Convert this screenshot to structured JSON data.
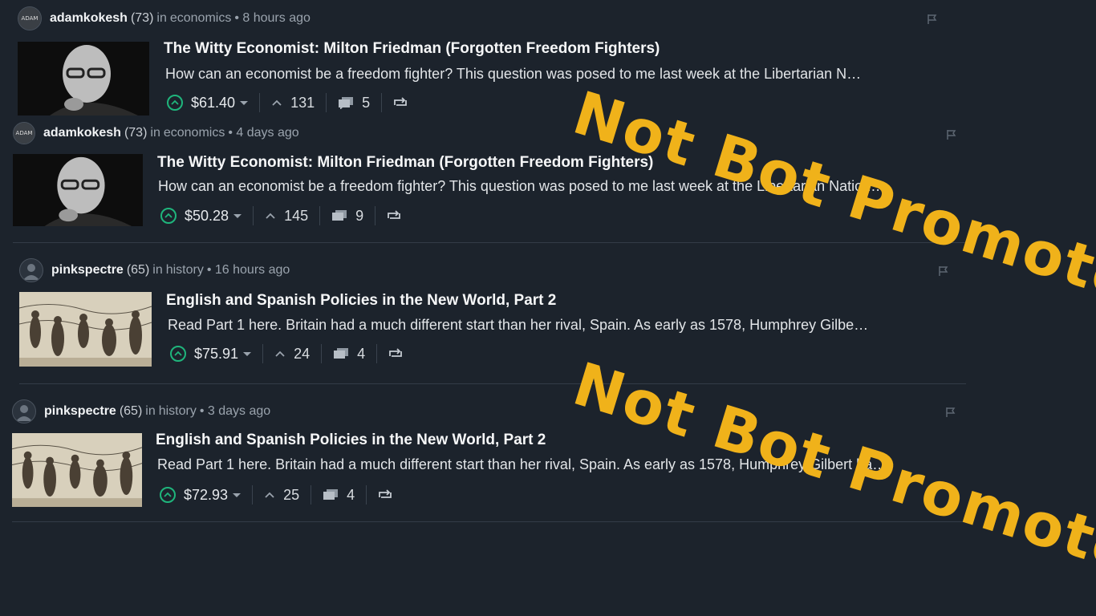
{
  "posts": [
    {
      "author": "adamkokesh",
      "rep": "(73)",
      "in": "in",
      "category": "economics",
      "time": "• 8 hours ago",
      "title": "The Witty Economist: Milton Friedman (Forgotten Freedom Fighters)",
      "body": "How can an economist be a freedom fighter? This question was posed to me last week at the Libertarian N…",
      "payout": "$61.40",
      "votes": "131",
      "comments": "5",
      "thumb": "milton"
    },
    {
      "author": "adamkokesh",
      "rep": "(73)",
      "in": "in",
      "category": "economics",
      "time": "• 4 days ago",
      "title": "The Witty Economist: Milton Friedman (Forgotten Freedom Fighters)",
      "body": "How can an economist be a freedom fighter? This question was posed to me last week at the Libertarian Nation…",
      "payout": "$50.28",
      "votes": "145",
      "comments": "9",
      "thumb": "milton"
    },
    {
      "author": "pinkspectre",
      "rep": "(65)",
      "in": "in",
      "category": "history",
      "time": "• 16 hours ago",
      "title": "English and Spanish Policies in the New World, Part 2",
      "body": "Read Part 1 here. Britain had a much different start than her rival, Spain. As early as 1578, Humphrey Gilbe…",
      "payout": "$75.91",
      "votes": "24",
      "comments": "4",
      "thumb": "engraving"
    },
    {
      "author": "pinkspectre",
      "rep": "(65)",
      "in": "in",
      "category": "history",
      "time": "• 3 days ago",
      "title": "English and Spanish Policies in the New World, Part 2",
      "body": "Read Part 1 here. Britain had a much different start than her rival, Spain. As early as 1578, Humphrey Gilbert ha…",
      "payout": "$72.93",
      "votes": "25",
      "comments": "4",
      "thumb": "engraving"
    }
  ],
  "stamps": [
    "Not Bot Promoted",
    "Not Bot Promoted"
  ],
  "colors": {
    "background": "#1c232c",
    "upvote_accent": "#1fb57c",
    "stamp": "#f0b21a"
  },
  "icons": {
    "vote": "upvote-circle-icon",
    "votes": "chevron-up-icon",
    "comments": "comments-icon",
    "reblog": "reblog-icon",
    "flag": "flag-icon"
  }
}
